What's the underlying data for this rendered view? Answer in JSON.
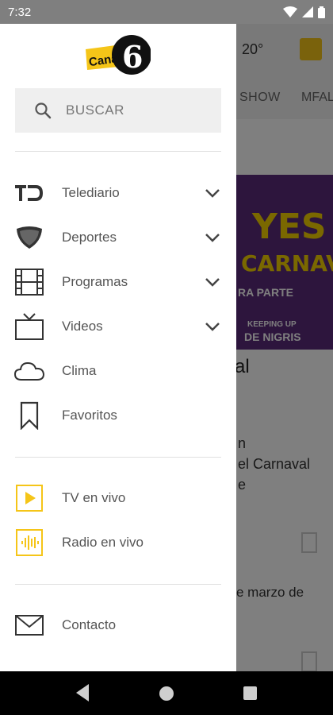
{
  "status_bar": {
    "time": "7:32"
  },
  "background": {
    "temperature": "20°",
    "tabs": [
      "SHOW",
      "MFAL"
    ],
    "hero_lines": [
      "YES",
      "CARNAVAL",
      "RA PARTE",
      "KEEPING UP",
      "DE NIGRIS"
    ],
    "title_fragment": "al",
    "text_lines": [
      "n",
      "el Carnaval",
      "e"
    ],
    "date_fragment": "e marzo de"
  },
  "drawer": {
    "logo_text": "Canal",
    "logo_number": "6",
    "search_label": "BUSCAR",
    "menu_items": [
      {
        "label": "Telediario",
        "icon": "telediario-logo-icon",
        "expandable": true
      },
      {
        "label": "Deportes",
        "icon": "shield-icon",
        "expandable": true
      },
      {
        "label": "Programas",
        "icon": "film-icon",
        "expandable": true
      },
      {
        "label": "Videos",
        "icon": "tv-icon",
        "expandable": true
      },
      {
        "label": "Clima",
        "icon": "cloud-icon",
        "expandable": false
      },
      {
        "label": "Favoritos",
        "icon": "bookmark-icon",
        "expandable": false
      }
    ],
    "live_items": [
      {
        "label": "TV en vivo",
        "icon": "play-icon"
      },
      {
        "label": "Radio en vivo",
        "icon": "audio-wave-icon"
      }
    ],
    "contact": {
      "label": "Contacto",
      "icon": "mail-icon"
    }
  },
  "colors": {
    "accent": "#f5c518",
    "text": "#555555",
    "icon": "#333333"
  }
}
